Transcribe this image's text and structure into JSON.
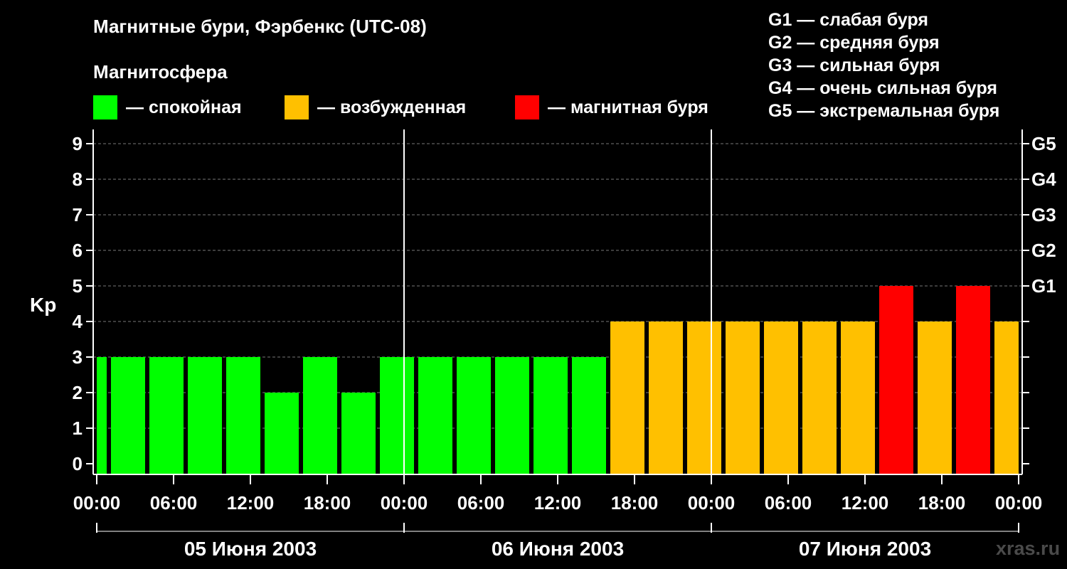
{
  "title": "Магнитные бури, Фэрбенкс (UTC-08)",
  "subtitle": "Магнитосфера",
  "legend": [
    {
      "label": "— спокойная",
      "color": "#00ff00"
    },
    {
      "label": "— возбужденная",
      "color": "#ffc000"
    },
    {
      "label": "— магнитная буря",
      "color": "#ff0000"
    }
  ],
  "g_legend": [
    "G1 — слабая буря",
    "G2 — средняя буря",
    "G3 — сильная буря",
    "G4 — очень сильная буря",
    "G5 — экстремальная буря"
  ],
  "watermark": "xras.ru",
  "colors": {
    "quiet": "#00ff00",
    "active": "#ffc000",
    "storm": "#ff0000"
  },
  "chart_data": {
    "type": "bar",
    "ylabel": "Kp",
    "ylim": [
      0,
      9
    ],
    "y_ticks": [
      0,
      1,
      2,
      3,
      4,
      5,
      6,
      7,
      8,
      9
    ],
    "right_ticks": [
      {
        "kp": 5,
        "label": "G1"
      },
      {
        "kp": 6,
        "label": "G2"
      },
      {
        "kp": 7,
        "label": "G3"
      },
      {
        "kp": 8,
        "label": "G4"
      },
      {
        "kp": 9,
        "label": "G5"
      }
    ],
    "x_tick_labels": [
      "00:00",
      "06:00",
      "12:00",
      "18:00",
      "00:00",
      "06:00",
      "12:00",
      "18:00",
      "00:00",
      "06:00",
      "12:00",
      "18:00",
      "00:00"
    ],
    "days": [
      "05 Июня 2003",
      "06 Июня 2003",
      "07 Июня 2003"
    ],
    "x_range_hours": [
      0,
      72
    ],
    "grid": "dashed horizontal at each Kp",
    "bars": [
      {
        "start_h": 0,
        "end_h": 1,
        "kp": 3,
        "level": "quiet"
      },
      {
        "start_h": 1,
        "end_h": 4,
        "kp": 3,
        "level": "quiet"
      },
      {
        "start_h": 4,
        "end_h": 7,
        "kp": 3,
        "level": "quiet"
      },
      {
        "start_h": 7,
        "end_h": 10,
        "kp": 3,
        "level": "quiet"
      },
      {
        "start_h": 10,
        "end_h": 13,
        "kp": 3,
        "level": "quiet"
      },
      {
        "start_h": 13,
        "end_h": 16,
        "kp": 2,
        "level": "quiet"
      },
      {
        "start_h": 16,
        "end_h": 19,
        "kp": 3,
        "level": "quiet"
      },
      {
        "start_h": 19,
        "end_h": 22,
        "kp": 2,
        "level": "quiet"
      },
      {
        "start_h": 22,
        "end_h": 25,
        "kp": 3,
        "level": "quiet"
      },
      {
        "start_h": 25,
        "end_h": 28,
        "kp": 3,
        "level": "quiet"
      },
      {
        "start_h": 28,
        "end_h": 31,
        "kp": 3,
        "level": "quiet"
      },
      {
        "start_h": 31,
        "end_h": 34,
        "kp": 3,
        "level": "quiet"
      },
      {
        "start_h": 34,
        "end_h": 37,
        "kp": 3,
        "level": "quiet"
      },
      {
        "start_h": 37,
        "end_h": 40,
        "kp": 3,
        "level": "quiet"
      },
      {
        "start_h": 40,
        "end_h": 43,
        "kp": 4,
        "level": "active"
      },
      {
        "start_h": 43,
        "end_h": 46,
        "kp": 4,
        "level": "active"
      },
      {
        "start_h": 46,
        "end_h": 49,
        "kp": 4,
        "level": "active"
      },
      {
        "start_h": 49,
        "end_h": 52,
        "kp": 4,
        "level": "active"
      },
      {
        "start_h": 52,
        "end_h": 55,
        "kp": 4,
        "level": "active"
      },
      {
        "start_h": 55,
        "end_h": 58,
        "kp": 4,
        "level": "active"
      },
      {
        "start_h": 58,
        "end_h": 61,
        "kp": 4,
        "level": "active"
      },
      {
        "start_h": 61,
        "end_h": 64,
        "kp": 5,
        "level": "storm"
      },
      {
        "start_h": 64,
        "end_h": 67,
        "kp": 4,
        "level": "active"
      },
      {
        "start_h": 67,
        "end_h": 70,
        "kp": 5,
        "level": "storm"
      },
      {
        "start_h": 70,
        "end_h": 72,
        "kp": 4,
        "level": "active"
      }
    ]
  }
}
